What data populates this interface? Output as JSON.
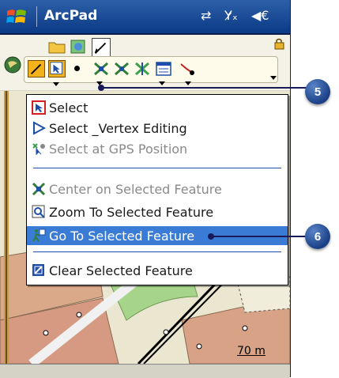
{
  "app": {
    "title": "ArcPad"
  },
  "status": {
    "connectivity": "⇄",
    "signal": "Y̷ₓ",
    "volume": "◀€"
  },
  "menu": {
    "items": [
      {
        "label": "Select",
        "enabled": true
      },
      {
        "label": "Select _Vertex Editing",
        "enabled": true
      },
      {
        "label": "Select at GPS Position",
        "enabled": false
      },
      {
        "label": "Center on Selected Feature",
        "enabled": false
      },
      {
        "label": "Zoom To Selected Feature",
        "enabled": true
      },
      {
        "label": "Go To Selected Feature",
        "enabled": true,
        "highlighted": true
      },
      {
        "label": "Clear Selected Feature",
        "enabled": true
      }
    ]
  },
  "map": {
    "scale_label": "70 m"
  },
  "callouts": {
    "first": "5",
    "second": "6"
  },
  "colors": {
    "title_bar": "#0c3a86",
    "highlight": "#3a7bd5",
    "selected_tool": "#f3b21a",
    "callout": "#1a3f86"
  }
}
